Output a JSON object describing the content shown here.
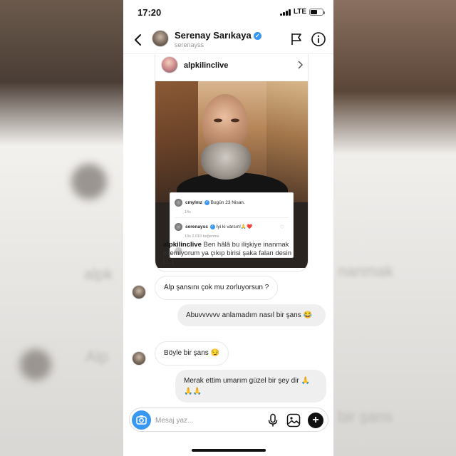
{
  "status_bar": {
    "time": "17:20",
    "network": "LTE"
  },
  "header": {
    "name": "Serenay Sarıkaya",
    "username": "serenayss"
  },
  "shared_post": {
    "username": "alpkilinclive",
    "comments": [
      {
        "user": "cmylmz",
        "text": "Bugün 23 Nisan.",
        "meta": "14s"
      },
      {
        "user": "serenayss",
        "text": "İyi ki varsın!🙏❤️",
        "meta": "13s   2.010 beğenme"
      }
    ],
    "caption_user": "alpkilinclive",
    "caption_text": "Ben hâlâ bu ilişkiye inanmak istemiyorum ya çıkıp birisi şaka falan desin",
    "caption_more": "[…]"
  },
  "messages": [
    {
      "direction": "in",
      "text": "Alp şansını çok mu zorluyorsun ?"
    },
    {
      "direction": "out",
      "text": "Abuvvvvvv anlamadım nasıl bir şans 😂"
    },
    {
      "direction": "in",
      "text": "Böyle bir şans 😏"
    },
    {
      "direction": "out",
      "text": "Merak ettim umarım güzel bir şey dir 🙏🙏🙏"
    }
  ],
  "composer": {
    "placeholder": "Mesaj yaz..."
  },
  "icons": {
    "back": "chevron-left-icon",
    "flag": "flag-icon",
    "info": "info-icon",
    "camera": "camera-icon",
    "mic": "microphone-icon",
    "gallery": "gallery-icon",
    "plus": "plus-icon"
  },
  "colors": {
    "accent": "#3897f0",
    "bubble_out": "#efefef"
  }
}
